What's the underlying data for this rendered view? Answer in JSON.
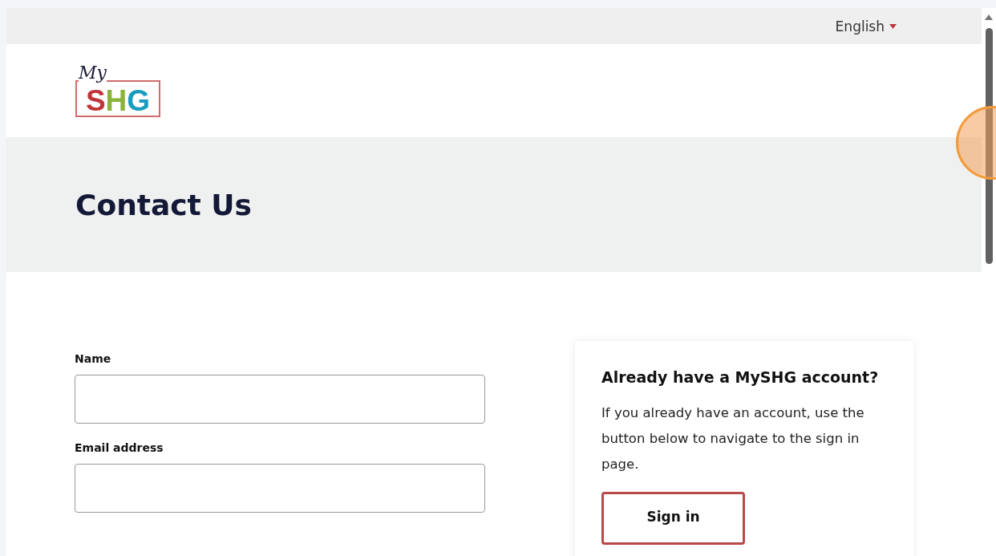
{
  "top_bar": {
    "language": "English"
  },
  "logo": {
    "script": "My",
    "letters": [
      {
        "text": "S",
        "color": "#c0353a"
      },
      {
        "text": "H",
        "color": "#8ab43c"
      },
      {
        "text": "G",
        "color": "#1a9bc0"
      }
    ]
  },
  "hero": {
    "title": "Contact Us"
  },
  "form": {
    "fields": [
      {
        "label": "Name"
      },
      {
        "label": "Email address"
      }
    ]
  },
  "signin_card": {
    "title": "Already have a MySHG account?",
    "text": "If you already have an account, use the button below to navigate to the sign in page.",
    "button": "Sign in"
  }
}
